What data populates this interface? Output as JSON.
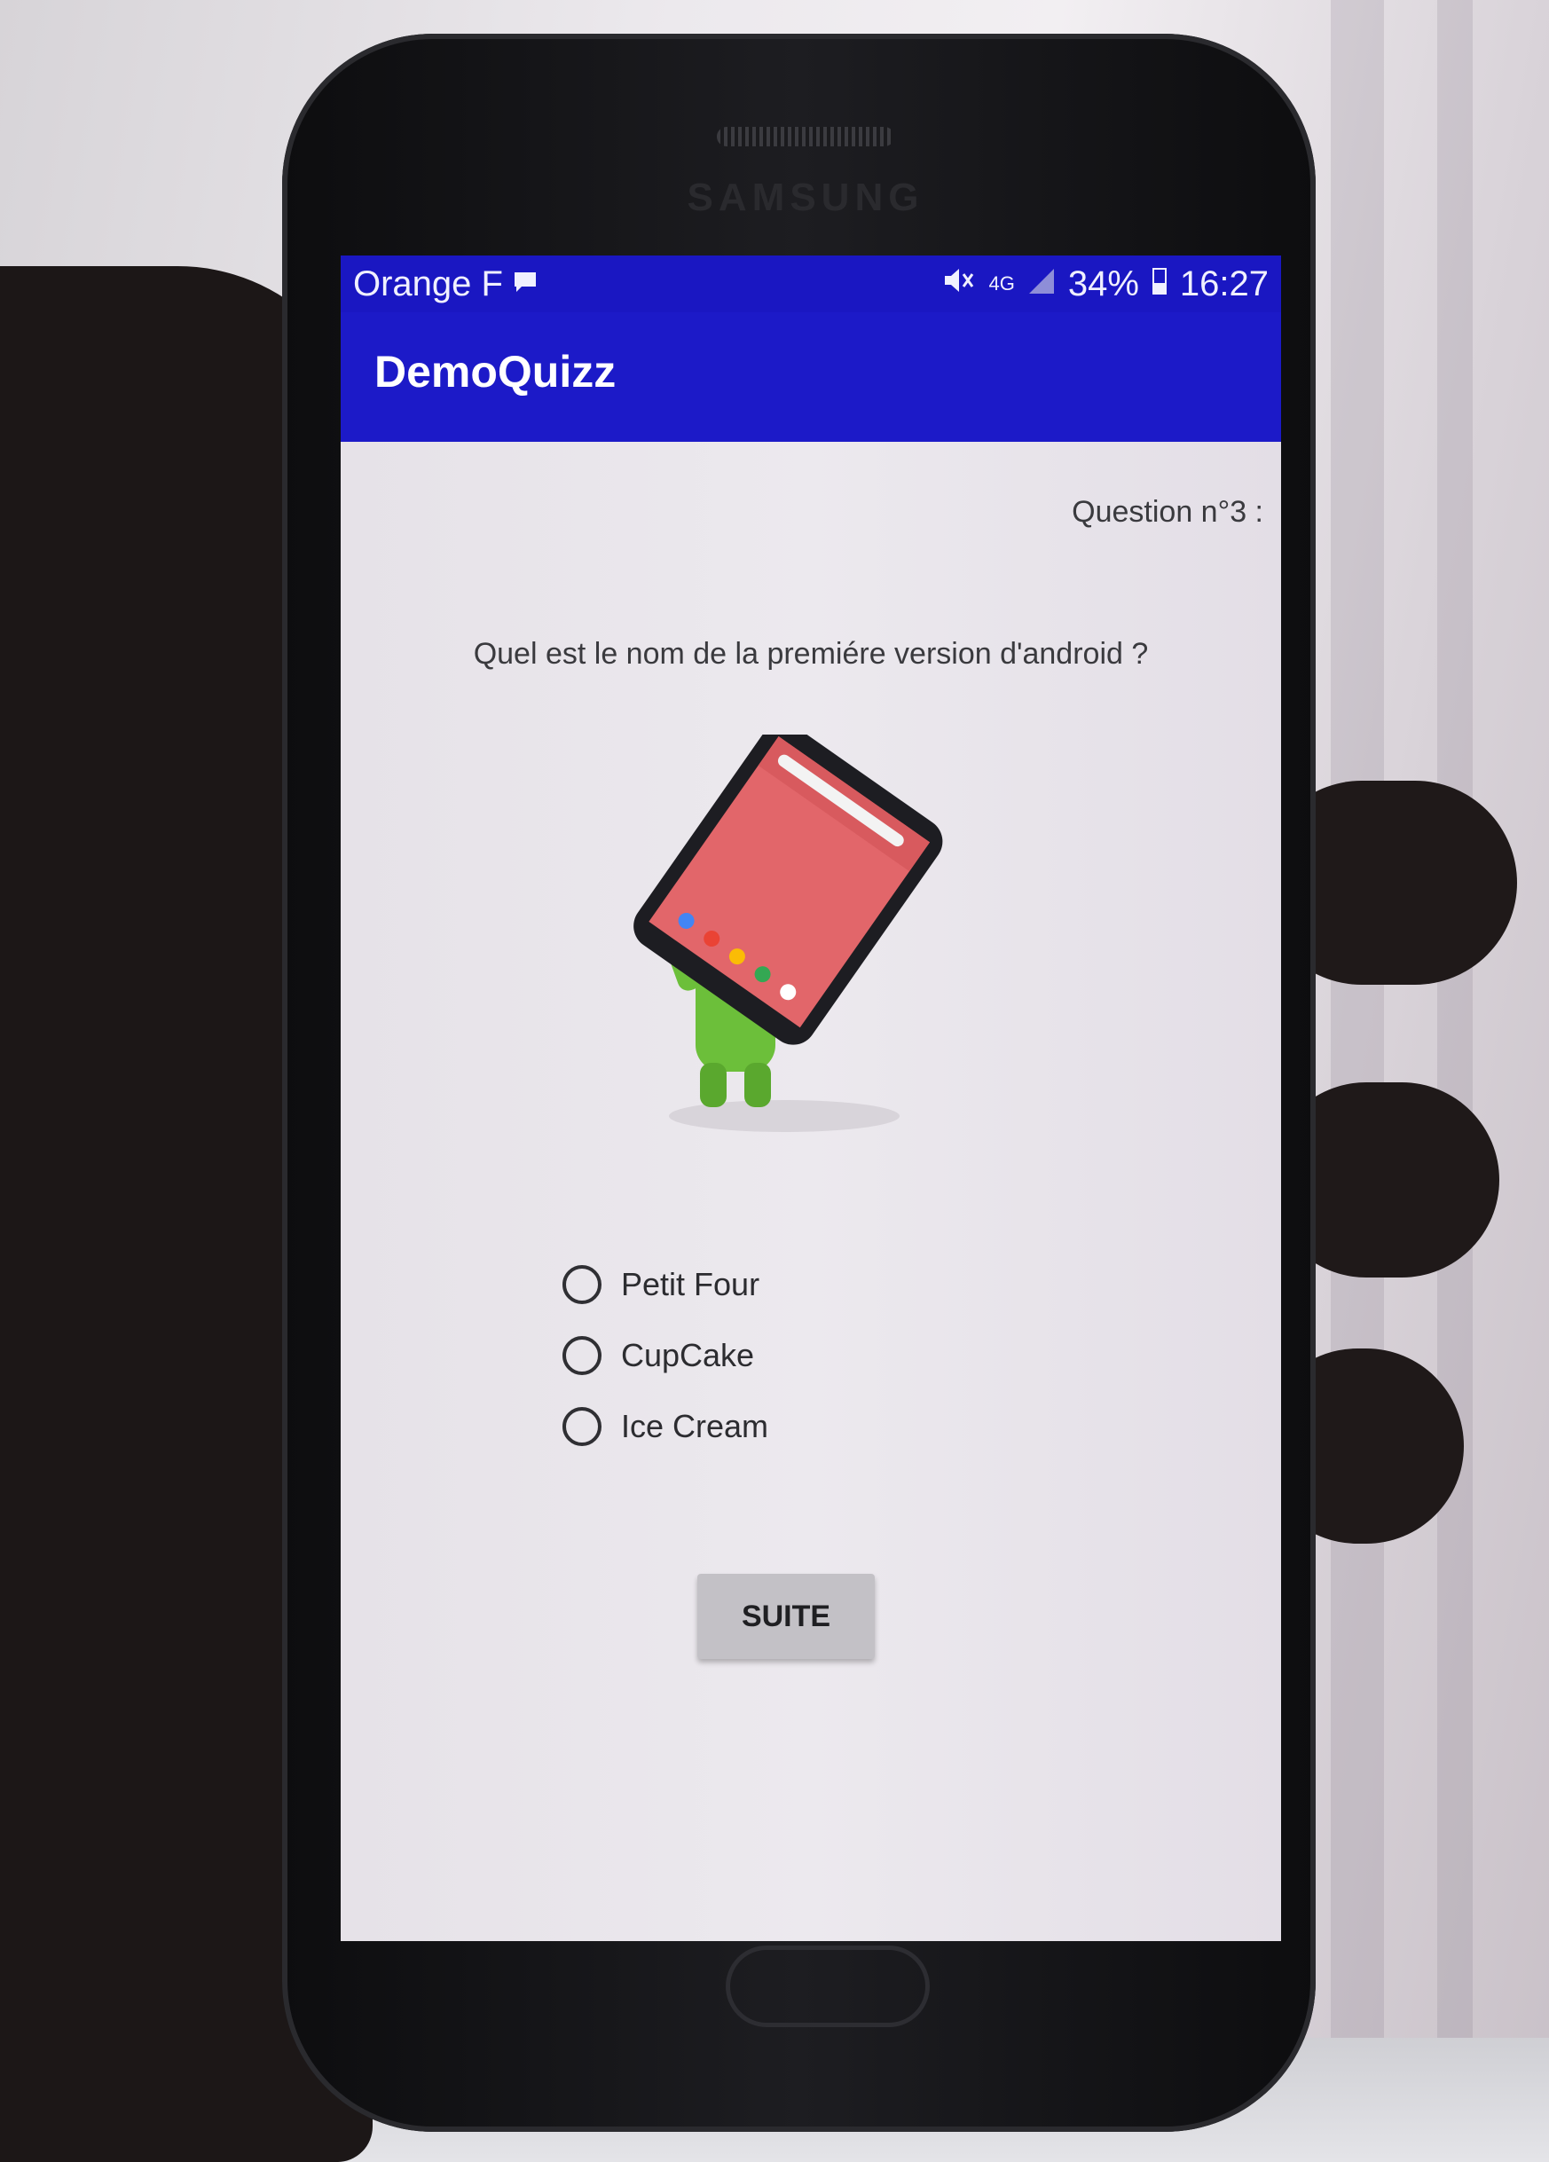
{
  "status_bar": {
    "carrier": "Orange F",
    "network": "4G",
    "battery": "34%",
    "time": "16:27",
    "icons": [
      "message-icon",
      "mute-icon",
      "signal-icon",
      "battery-icon"
    ]
  },
  "device": {
    "brand": "SAMSUNG"
  },
  "app_bar": {
    "title": "DemoQuizz"
  },
  "quiz": {
    "question_number": "Question n°3 :",
    "question": "Quel est le nom de la premiére version d'android ?",
    "options": [
      {
        "label": "Petit Four",
        "selected": false
      },
      {
        "label": "CupCake",
        "selected": false
      },
      {
        "label": "Ice Cream",
        "selected": false
      }
    ],
    "next_button": "SUITE"
  },
  "colors": {
    "app_bar": "#1c1ac8",
    "status_bar": "#1a17c2",
    "screen_bg": "#ebe8ec",
    "button_bg": "#c3c1c6"
  }
}
